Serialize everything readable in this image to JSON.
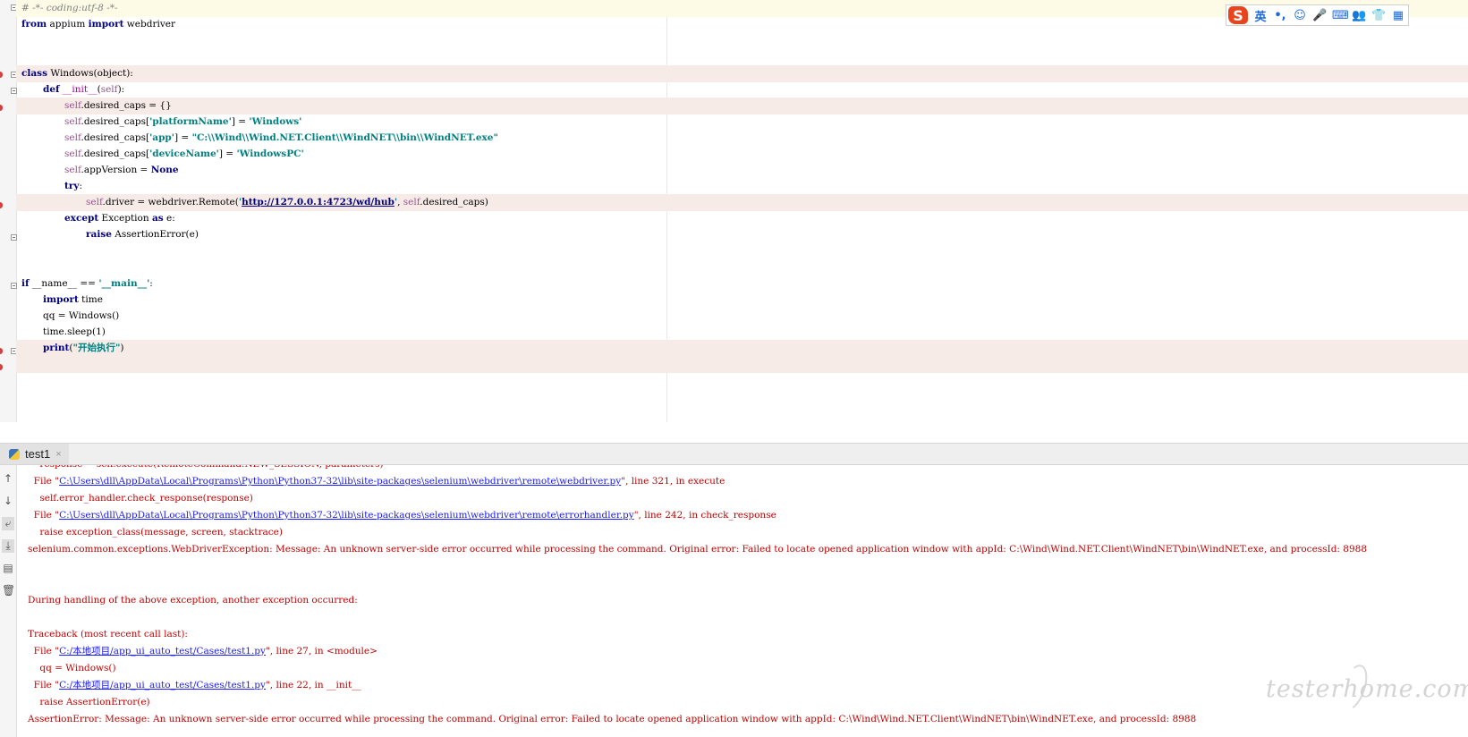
{
  "editor": {
    "code": {
      "l1": "# -*- coding:utf-8 -*-",
      "l2a": "from",
      "l2b": " appium ",
      "l2c": "import",
      "l2d": " webdriver",
      "l5a": "class",
      "l5b": " Windows(object):",
      "l6a": "def",
      "l6b": " __init__",
      "l6c": "(",
      "l6d": "self",
      "l6e": "):",
      "l7a": "self",
      "l7b": ".desired_caps = {}",
      "l8a": "self",
      "l8b": ".desired_caps[",
      "l8c": "'platformName'",
      "l8d": "] = ",
      "l8e": "'Windows'",
      "l9a": "self",
      "l9b": ".desired_caps[",
      "l9c": "'app'",
      "l9d": "] = ",
      "l9e": "\"C:\\\\Wind\\\\Wind.NET.Client\\\\WindNET\\\\bin\\\\WindNET.exe\"",
      "l10a": "self",
      "l10b": ".desired_caps[",
      "l10c": "'deviceName'",
      "l10d": "] = ",
      "l10e": "'WindowsPC'",
      "l11a": "self",
      "l11b": ".appVersion = ",
      "l11c": "None",
      "l12a": "try",
      "l12b": ":",
      "l13a": "self",
      "l13b": ".driver = webdriver.Remote(",
      "l13c": "'",
      "l13d": "http://127.0.0.1:4723/wd/hub",
      "l13e": "'",
      "l13f": ", ",
      "l13g": "self",
      "l13h": ".desired_caps)",
      "l14a": "except",
      "l14b": " Exception ",
      "l14c": "as",
      "l14d": " e:",
      "l15a": "raise",
      "l15b": " AssertionError(e)",
      "l18a": "if",
      "l18b": " __name__ == ",
      "l18c": "'__main__'",
      "l18d": ":",
      "l19a": "import",
      "l19b": " time",
      "l20": "qq = Windows()",
      "l21": "time.sleep(1)",
      "l22a": "print",
      "l22b": "(",
      "l22c": "\"开始执行\"",
      "l22d": ")"
    }
  },
  "ime": {
    "logo": "S",
    "items": [
      "英",
      "•,",
      "☺",
      "🎤",
      "⌨",
      "👥",
      "👕",
      "▦"
    ]
  },
  "run_panel": {
    "tab_label": "test1",
    "tab_close": "×"
  },
  "console": {
    "lines": {
      "c0": "    response = self.execute(RemoteCommand.NEW_SESSION, parameters)",
      "c1a": "  File \"",
      "c1b": "C:\\Users\\dll\\AppData\\Local\\Programs\\Python\\Python37-32\\lib\\site-packages\\selenium\\webdriver\\remote\\webdriver.py",
      "c1c": "\", line 321, in execute",
      "c2": "    self.error_handler.check_response(response)",
      "c3a": "  File \"",
      "c3b": "C:\\Users\\dll\\AppData\\Local\\Programs\\Python\\Python37-32\\lib\\site-packages\\selenium\\webdriver\\remote\\errorhandler.py",
      "c3c": "\", line 242, in check_response",
      "c4": "    raise exception_class(message, screen, stacktrace)",
      "c5": "selenium.common.exceptions.WebDriverException: Message: An unknown server-side error occurred while processing the command. Original error: Failed to locate opened application window with appId: C:\\Wind\\Wind.NET.Client\\WindNET\\bin\\WindNET.exe, and processId: 8988",
      "c8": "During handling of the above exception, another exception occurred:",
      "c10": "Traceback (most recent call last):",
      "c11a": "  File \"",
      "c11b": "C:/本地项目/app_ui_auto_test/Cases/test1.py",
      "c11c": "\", line 27, in <module>",
      "c12": "    qq = Windows()",
      "c13a": "  File \"",
      "c13b": "C:/本地项目/app_ui_auto_test/Cases/test1.py",
      "c13c": "\", line 22, in __init__",
      "c14": "    raise AssertionError(e)",
      "c15": "AssertionError: Message: An unknown server-side error occurred while processing the command. Original error: Failed to locate opened application window with appId: C:\\Wind\\Wind.NET.Client\\WindNET\\bin\\WindNET.exe, and processId: 8988"
    }
  },
  "watermark": "testerhome.com",
  "colors": {
    "keyword": "#000080",
    "string": "#008080",
    "self": "#94558d",
    "error_text": "#c00000",
    "link": "#1a1aff",
    "highlight": "#f7ebe8"
  }
}
